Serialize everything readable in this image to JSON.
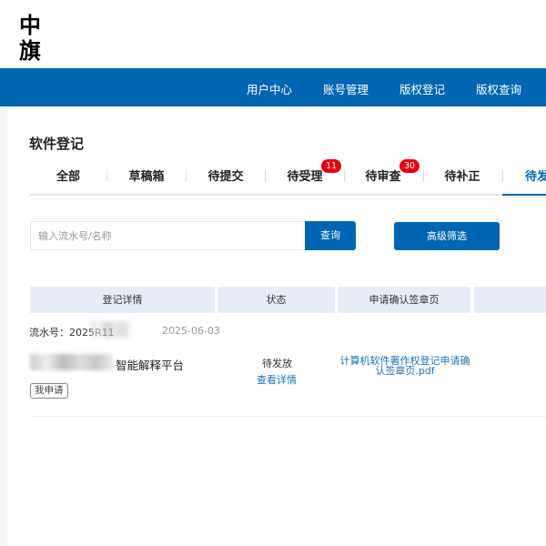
{
  "logo": "中旗",
  "nav": {
    "items": [
      "用户中心",
      "账号管理",
      "版权登记",
      "版权查询"
    ]
  },
  "page_title": "软件登记",
  "tabs": [
    {
      "label": "全部"
    },
    {
      "label": "草稿箱"
    },
    {
      "label": "待提交"
    },
    {
      "label": "待受理",
      "badge": "11"
    },
    {
      "label": "待审查",
      "badge": "30"
    },
    {
      "label": "待补正"
    },
    {
      "label": "待发",
      "active": true
    }
  ],
  "search": {
    "placeholder": "输入流水号/名称",
    "button": "查询",
    "advanced": "高级筛选"
  },
  "table": {
    "headers": [
      "登记详情",
      "状态",
      "申请确认签章页",
      ""
    ],
    "rows": [
      {
        "serial_label": "流水号：2025R11",
        "date": "2025-06-03",
        "name": "智能解释平台",
        "status": "待发放",
        "detail_link": "查看详情",
        "file": "计算机软件著作权登记申请确认签章页.pdf",
        "tag": "我申请"
      }
    ]
  },
  "colors": {
    "primary": "#0066b3",
    "badge": "#e60012",
    "link": "#2072b8",
    "header_bg": "#e6edf7"
  }
}
